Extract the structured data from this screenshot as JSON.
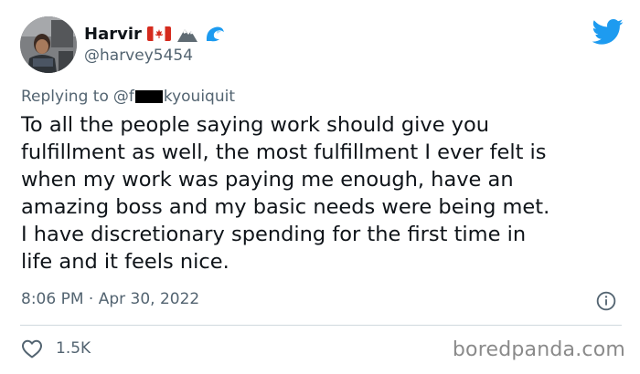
{
  "tweet": {
    "author": {
      "display_name": "Harvir",
      "handle": "@harvey5454",
      "name_emojis": [
        "canada-flag",
        "mountain",
        "wave"
      ]
    },
    "reply_to": {
      "prefix": "Replying to",
      "mention_start": "@f",
      "mention_end": "kyouiquit"
    },
    "text_lines": [
      "To all the people saying work should give you",
      "fulfillment as well, the most fulfillment I ever felt is",
      "when my work was paying me enough, have an",
      "amazing boss and my basic needs were being met.",
      "I have discretionary spending for the first time in",
      "life and it feels nice."
    ],
    "timestamp": "8:06 PM · Apr 30, 2022",
    "like_count": "1.5K"
  },
  "watermark": "boredpanda.com",
  "colors": {
    "twitter_blue": "#1d9bf0",
    "secondary_text": "#536471",
    "primary_text": "#0f1419",
    "divider": "#cfd9de",
    "watermark": "#8a8a8a"
  },
  "icons": {
    "brand": "twitter-bird-icon",
    "info": "info-icon",
    "like": "heart-icon"
  }
}
